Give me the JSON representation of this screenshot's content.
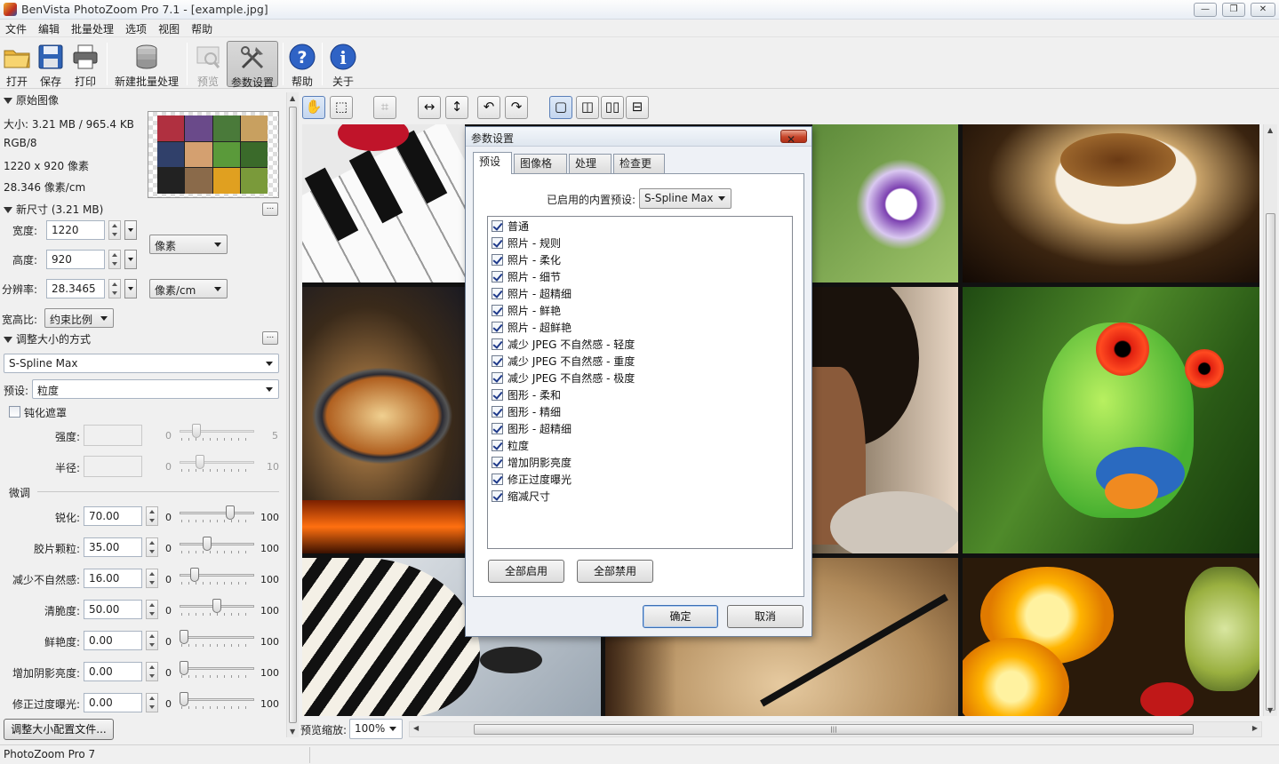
{
  "window": {
    "title": "BenVista PhotoZoom Pro 7.1 - [example.jpg]",
    "min": "—",
    "max": "❐",
    "close": "✕"
  },
  "menu": [
    "文件",
    "编辑",
    "批量处理",
    "选项",
    "视图",
    "帮助"
  ],
  "toolbar": {
    "open": "打开",
    "save": "保存",
    "print": "打印",
    "batch": "新建批量处理",
    "preview": "预览",
    "settings": "参数设置",
    "help": "帮助",
    "about": "关于"
  },
  "original": {
    "header": "原始图像",
    "size": "大小: 3.21 MB / 965.4 KB",
    "mode": "RGB/8",
    "dims": "1220 x 920 像素",
    "res": "28.346 像素/cm"
  },
  "newsize": {
    "header": "新尺寸 (3.21 MB)",
    "width_label": "宽度:",
    "width": "1220",
    "height_label": "高度:",
    "height": "920",
    "res_label": "分辨率:",
    "res": "28.3465",
    "unit": "像素",
    "res_unit": "像素/cm",
    "aspect_label": "宽高比:",
    "aspect": "约束比例",
    "more": "..."
  },
  "method": {
    "header": "调整大小的方式",
    "algorithm": "S-Spline Max",
    "preset_label": "预设:",
    "preset": "粒度",
    "unsharp": "钝化遮罩",
    "strength": "强度:",
    "strength_min": "0",
    "strength_max": "5",
    "radius": "半径:",
    "radius_min": "0",
    "radius_max": "10",
    "more": "..."
  },
  "finetune": {
    "header": "微调",
    "rows": [
      {
        "label": "锐化:",
        "value": "70.00",
        "min": "0",
        "max": "100",
        "pos": 0.7
      },
      {
        "label": "胶片颗粒:",
        "value": "35.00",
        "min": "0",
        "max": "100",
        "pos": 0.35
      },
      {
        "label": "减少不自然感:",
        "value": "16.00",
        "min": "0",
        "max": "100",
        "pos": 0.16
      },
      {
        "label": "清脆度:",
        "value": "50.00",
        "min": "0",
        "max": "100",
        "pos": 0.5
      },
      {
        "label": "鲜艳度:",
        "value": "0.00",
        "min": "0",
        "max": "100",
        "pos": 0.0
      },
      {
        "label": "增加阴影亮度:",
        "value": "0.00",
        "min": "0",
        "max": "100",
        "pos": 0.0
      },
      {
        "label": "修正过度曝光:",
        "value": "0.00",
        "min": "0",
        "max": "100",
        "pos": 0.0
      }
    ],
    "profile_btn": "调整大小配置文件..."
  },
  "preview": {
    "zoom_label": "预览缩放:",
    "zoom": "100%",
    "hgrip": "|||"
  },
  "status": "PhotoZoom Pro 7",
  "dialog": {
    "title": "参数设置",
    "tabs": [
      "预设",
      "图像格式",
      "处理",
      "检查更新"
    ],
    "builtin_label": "已启用的内置预设:",
    "builtin_value": "S-Spline Max",
    "presets": [
      "普通",
      "照片 - 规则",
      "照片 - 柔化",
      "照片 - 细节",
      "照片 - 超精细",
      "照片 - 鲜艳",
      "照片 - 超鲜艳",
      "减少 JPEG 不自然感 - 轻度",
      "减少 JPEG 不自然感 - 重度",
      "减少 JPEG 不自然感 - 极度",
      "图形 - 柔和",
      "图形 - 精细",
      "图形 - 超精细",
      "粒度",
      "增加阴影亮度",
      "修正过度曝光",
      "缩减尺寸"
    ],
    "enable_all": "全部启用",
    "disable_all": "全部禁用",
    "ok": "确定",
    "cancel": "取消"
  },
  "colors": {
    "accent": "#3c6fb4",
    "close": "#c7452a"
  }
}
